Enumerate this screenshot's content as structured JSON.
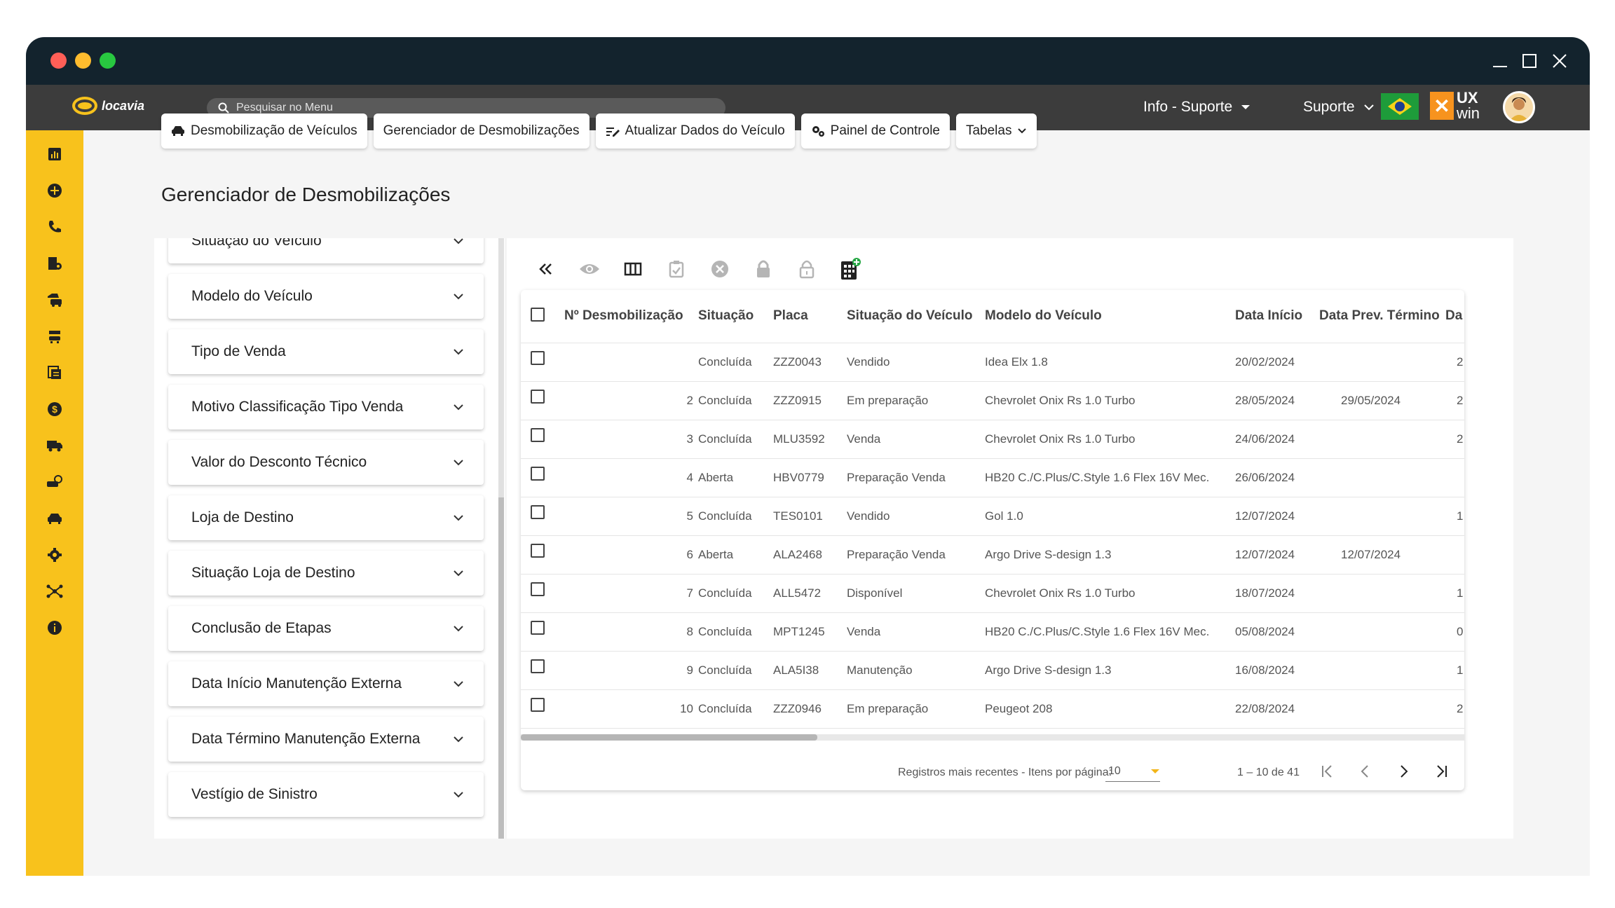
{
  "app": {
    "logo_text": "locavia",
    "search_placeholder": "Pesquisar no Menu",
    "menu_info": "Info - Suporte",
    "menu_support": "Suporte",
    "uxwin_top": "UX",
    "uxwin_bottom": "win"
  },
  "tabs": [
    {
      "label": "Desmobilização de Veículos",
      "icon": "car-icon"
    },
    {
      "label": "Gerenciador de Desmobilizações",
      "icon": ""
    },
    {
      "label": "Atualizar Dados do Veículo",
      "icon": "edit-list-icon"
    },
    {
      "label": "Painel de Controle",
      "icon": "gears-icon"
    },
    {
      "label": "Tabelas",
      "icon": "chevron-down-icon"
    }
  ],
  "page_title": "Gerenciador de Desmobilizações",
  "filters": [
    "Situação do Veículo",
    "Modelo do Veículo",
    "Tipo de Venda",
    "Motivo Classificação Tipo Venda",
    "Valor do Desconto Técnico",
    "Loja de Destino",
    "Situação Loja de Destino",
    "Conclusão de Etapas",
    "Data Início Manutenção Externa",
    "Data Término Manutenção Externa",
    "Vestígio de Sinistro"
  ],
  "table": {
    "headers": [
      "Nº Desmobilização",
      "Situação",
      "Placa",
      "Situação do Veículo",
      "Modelo do Veículo",
      "Data Início",
      "Data Prev. Término",
      "Da"
    ],
    "rows": [
      {
        "n": "",
        "sit": "Concluída",
        "placa": "ZZZ0043",
        "sitv": "Vendido",
        "modelo": "Idea Elx 1.8",
        "inicio": "20/02/2024",
        "prev": "",
        "da": "2"
      },
      {
        "n": "2",
        "sit": "Concluída",
        "placa": "ZZZ0915",
        "sitv": "Em preparação",
        "modelo": "Chevrolet Onix Rs 1.0 Turbo",
        "inicio": "28/05/2024",
        "prev": "29/05/2024",
        "da": "2"
      },
      {
        "n": "3",
        "sit": "Concluída",
        "placa": "MLU3592",
        "sitv": "Venda",
        "modelo": "Chevrolet Onix Rs 1.0 Turbo",
        "inicio": "24/06/2024",
        "prev": "",
        "da": "2"
      },
      {
        "n": "4",
        "sit": "Aberta",
        "placa": "HBV0779",
        "sitv": "Preparação Venda",
        "modelo": "HB20 C./C.Plus/C.Style 1.6 Flex 16V Mec.",
        "inicio": "26/06/2024",
        "prev": "",
        "da": ""
      },
      {
        "n": "5",
        "sit": "Concluída",
        "placa": "TES0101",
        "sitv": "Vendido",
        "modelo": "Gol 1.0",
        "inicio": "12/07/2024",
        "prev": "",
        "da": "1"
      },
      {
        "n": "6",
        "sit": "Aberta",
        "placa": "ALA2468",
        "sitv": "Preparação Venda",
        "modelo": "Argo Drive S-design 1.3",
        "inicio": "12/07/2024",
        "prev": "12/07/2024",
        "da": ""
      },
      {
        "n": "7",
        "sit": "Concluída",
        "placa": "ALL5472",
        "sitv": "Disponível",
        "modelo": "Chevrolet Onix Rs 1.0 Turbo",
        "inicio": "18/07/2024",
        "prev": "",
        "da": "1"
      },
      {
        "n": "8",
        "sit": "Concluída",
        "placa": "MPT1245",
        "sitv": "Venda",
        "modelo": "HB20 C./C.Plus/C.Style 1.6 Flex 16V Mec.",
        "inicio": "05/08/2024",
        "prev": "",
        "da": "0"
      },
      {
        "n": "9",
        "sit": "Concluída",
        "placa": "ALA5I38",
        "sitv": "Manutenção",
        "modelo": "Argo Drive S-design 1.3",
        "inicio": "16/08/2024",
        "prev": "",
        "da": "1"
      },
      {
        "n": "10",
        "sit": "Concluída",
        "placa": "ZZZ0946",
        "sitv": "Em preparação",
        "modelo": "Peugeot 208",
        "inicio": "22/08/2024",
        "prev": "",
        "da": "2"
      }
    ]
  },
  "pager": {
    "label": "Registros mais recentes - Itens por página:",
    "page_size": "10",
    "range": "1 – 10 de 41"
  },
  "colors": {
    "titlebar": "#13232d",
    "appbar": "#3c3c3c",
    "sidebar": "#f8c21c",
    "close_dot": "#ff5f57",
    "min_dot": "#febc2e",
    "max_dot": "#28c840"
  }
}
